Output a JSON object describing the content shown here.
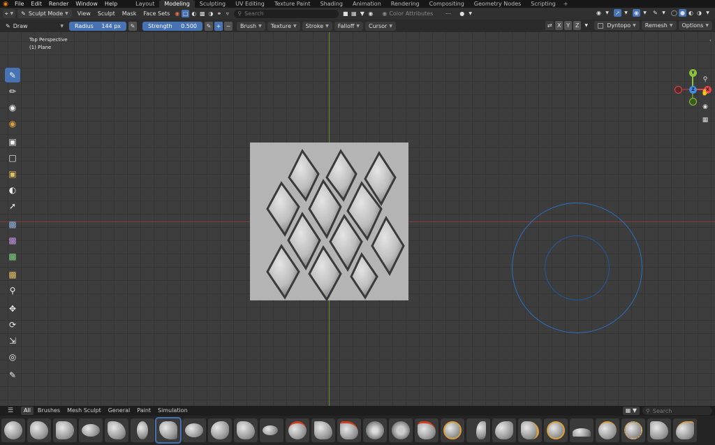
{
  "menubar": {
    "menus": [
      "File",
      "Edit",
      "Render",
      "Window",
      "Help"
    ],
    "workspaces": [
      "Layout",
      "Modeling",
      "Sculpting",
      "UV Editing",
      "Texture Paint",
      "Shading",
      "Animation",
      "Rendering",
      "Compositing",
      "Geometry Nodes",
      "Scripting"
    ],
    "active_workspace": "Modeling",
    "add_tab": "+"
  },
  "header": {
    "mode": "Sculpt Mode",
    "menus": [
      "View",
      "Sculpt",
      "Mask",
      "Face Sets"
    ],
    "search_placeholder": "Search",
    "color_attributes": "Color Attributes"
  },
  "toolbar": {
    "tool": "Draw",
    "radius_label": "Radius",
    "radius_value": "144 px",
    "strength_label": "Strength",
    "strength_value": "0.500",
    "menus": [
      "Brush",
      "Texture",
      "Stroke",
      "Falloff",
      "Cursor"
    ],
    "axes": [
      "X",
      "Y",
      "Z"
    ],
    "dyntopo": "Dyntopo",
    "remesh": "Remesh",
    "options": "Options"
  },
  "viewport": {
    "view_name": "Top Perspective",
    "object_name": "(1) Plane",
    "gizmo_labels": {
      "y": "Y",
      "x": "X",
      "z": "Z"
    }
  },
  "lefttools": [
    "brush-draw-icon",
    "brush-draw-sharp-icon",
    "brush-clay-icon",
    "brush-paint-icon",
    "box-mask-icon",
    "box-hide-icon",
    "box-face-set-icon",
    "box-trim-icon",
    "line-project-icon",
    "mesh-filter-icon",
    "cloth-filter-icon",
    "color-filter-icon",
    "edit-face-set-icon",
    "mask-by-color-icon",
    "move-icon",
    "rotate-icon",
    "scale-icon",
    "transform-icon",
    "annotate-icon"
  ],
  "shelf": {
    "tabs": [
      "All",
      "Brushes",
      "Mesh Sculpt",
      "General",
      "Paint",
      "Simulation"
    ],
    "active_tab": "All",
    "search_placeholder": "Search",
    "brush_count": 27
  },
  "colors": {
    "accent": "#4772b3",
    "x_axis": "#e8434c",
    "y_axis": "#8cc43a",
    "z_axis": "#3f8ee3"
  }
}
